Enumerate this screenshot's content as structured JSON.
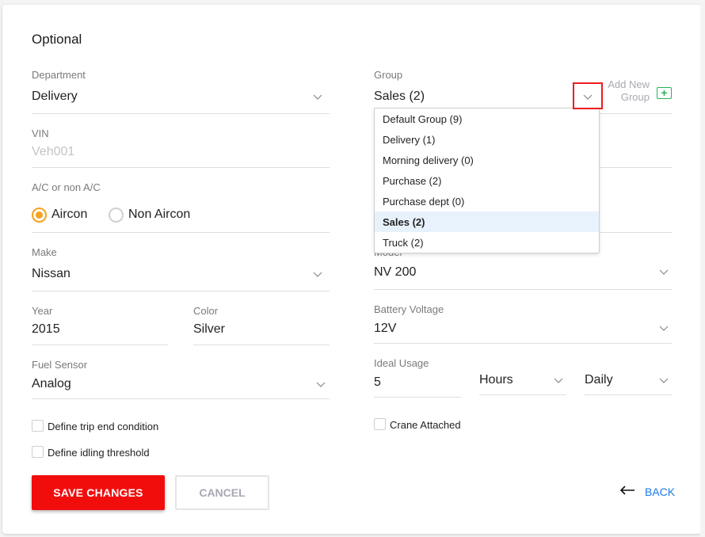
{
  "section_title": "Optional",
  "left": {
    "department": {
      "label": "Department",
      "value": "Delivery"
    },
    "vin": {
      "label": "VIN",
      "placeholder": "Veh001"
    },
    "ac": {
      "label": "A/C or non A/C",
      "options": [
        {
          "label": "Aircon",
          "selected": true
        },
        {
          "label": "Non Aircon",
          "selected": false
        }
      ]
    },
    "make": {
      "label": "Make",
      "value": "Nissan"
    },
    "year": {
      "label": "Year",
      "value": "2015"
    },
    "color": {
      "label": "Color",
      "value": "Silver"
    },
    "fuel_sensor": {
      "label": "Fuel Sensor",
      "value": "Analog"
    },
    "checkboxes": [
      {
        "label": "Define trip end condition",
        "checked": false
      },
      {
        "label": "Define idling threshold",
        "checked": false
      }
    ]
  },
  "right": {
    "group": {
      "label": "Group",
      "value": "Sales (2)",
      "add_new_line1": "Add New",
      "add_new_line2": "Group",
      "add_icon": "+",
      "options": [
        {
          "label": "Default Group (9)",
          "selected": false
        },
        {
          "label": "Delivery (1)",
          "selected": false
        },
        {
          "label": "Morning delivery (0)",
          "selected": false
        },
        {
          "label": "Purchase (2)",
          "selected": false
        },
        {
          "label": "Purchase dept (0)",
          "selected": false
        },
        {
          "label": "Sales (2)",
          "selected": true
        },
        {
          "label": "Truck (2)",
          "selected": false
        }
      ]
    },
    "model": {
      "label": "Model",
      "value": "NV 200"
    },
    "battery_voltage": {
      "label": "Battery Voltage",
      "value": "12V"
    },
    "ideal_usage": {
      "label": "Ideal Usage",
      "value": "5",
      "unit": "Hours",
      "period": "Daily"
    },
    "crane_attached": {
      "label": "Crane Attached",
      "checked": false
    }
  },
  "actions": {
    "save_label": "SAVE CHANGES",
    "cancel_label": "CANCEL",
    "back_label": "BACK",
    "back_icon": "←"
  },
  "colors": {
    "primary_red": "#f20d0d",
    "radio_orange": "#f7a21b",
    "link_blue": "#1a7ae8",
    "add_green": "#24b45a",
    "highlight_red": "#ee1c1c",
    "selected_option_bg": "#e8f2fd"
  }
}
